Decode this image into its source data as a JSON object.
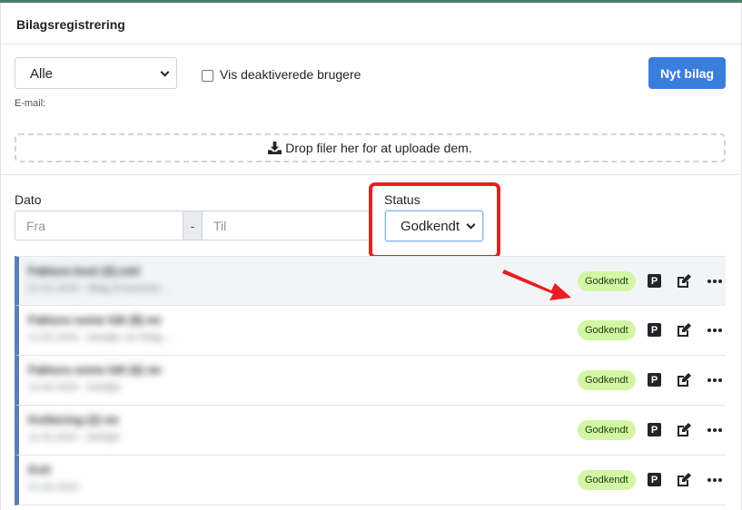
{
  "card": {
    "title": "Bilagsregistrering"
  },
  "filters": {
    "user_select_value": "Alle",
    "show_deactivated_label": "Vis deaktiverede brugere",
    "email_label": "E-mail:",
    "new_button_label": "Nyt bilag",
    "dropzone_text": "Drop filer her for at uploade dem.",
    "date_label": "Dato",
    "date_from_placeholder": "Fra",
    "date_separator": "-",
    "date_to_placeholder": "Til",
    "status_label": "Status",
    "status_value": "Godkendt"
  },
  "rows": [
    {
      "title": "Faktura kost (2).xml",
      "subtitle": "01-01-2024 - Bilag til kontoret ...",
      "status": "Godkendt"
    },
    {
      "title": "Faktura some lidt (8) mr",
      "subtitle": "12.02.2024 - Detaljer om bilag ...",
      "status": "Godkendt"
    },
    {
      "title": "Faktura some lidt (6) mr",
      "subtitle": "12.02.2024 - Detaljer",
      "status": "Godkendt"
    },
    {
      "title": "Kvittering (2) mr",
      "subtitle": "11.02.2024 - Detaljer",
      "status": "Godkendt"
    },
    {
      "title": "Kvit",
      "subtitle": "01.02.2024",
      "status": "Godkendt"
    }
  ],
  "icons": {
    "upload": "download-tray-icon",
    "parking": "p-icon",
    "edit": "edit-icon",
    "more": "ellipsis-icon"
  },
  "colors": {
    "primary": "#3b7ddd",
    "status_badge_bg": "#d3f6a5",
    "row_accent": "#5b7fb4",
    "annotation_red": "#ea1c24"
  }
}
